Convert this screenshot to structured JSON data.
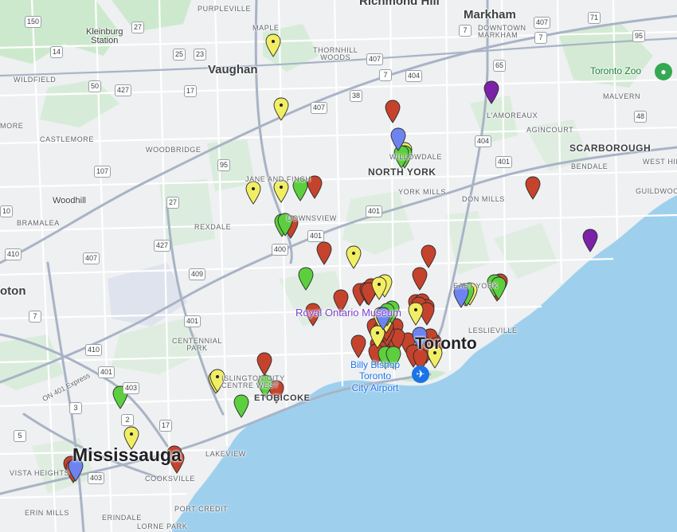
{
  "map": {
    "colors": {
      "land": "#eef0f1",
      "water": "#9ed0ee",
      "park": "#cde9cd",
      "highway": "#a9b3c6",
      "road": "#ffffff",
      "marker_red": "#c5432c",
      "marker_yellow": "#f2ee63",
      "marker_green": "#5ccf3e",
      "marker_blue": "#6d84f0",
      "marker_purple": "#7b22a8"
    },
    "labels": {
      "richmond_hill": "Richmond Hill",
      "markham": "Markham",
      "downtown_markham": "DOWNTOWN\nMARKHAM",
      "purpleville": "PURPLEVILLE",
      "maple": "MAPLE",
      "kleinburg_station": "Kleinburg\nStation",
      "vaughan": "Vaughan",
      "thornhill_woods": "THORNHILL\nWOODS",
      "toronto_zoo": "Toronto Zoo",
      "malvern": "MALVERN",
      "wildfield": "WILDFIELD",
      "lamoreaux": "L'AMOREAUX",
      "agincourt": "AGINCOURT",
      "more": "MORE",
      "castlemore": "CASTLEMORE",
      "woodbridge": "WOODBRIDGE",
      "willowdale": "WILLOWDALE",
      "north_york": "NORTH YORK",
      "scarborough": "SCARBOROUGH",
      "bendale": "BENDALE",
      "west_hill": "WEST HIL",
      "guildwood": "GUILDWOO",
      "jane_and_finch": "JANE AND FINCH",
      "woodhill": "Woodhill",
      "york_mills": "YORK MILLS",
      "don_mills": "DON MILLS",
      "bramalea": "BRAMALEA",
      "downsview": "DOWNSVIEW",
      "rexdale": "REXDALE",
      "east_york": "EAST YORK",
      "oton": "oton",
      "rom": "Royal Ontario Museum",
      "leslieville": "LESLIEVILLE",
      "centennial_park": "CENTENNIAL\nPARK",
      "toronto": "Toronto",
      "airport": "Billy Bishop\nToronto\nCity Airport",
      "islington": "ISLINGTON CITY\nCENTRE WEST",
      "etobicoke": "ETOBICOKE",
      "on401express": "ON 401 Express",
      "mississauga": "Mississauga",
      "lakeview": "LAKEVIEW",
      "vista_heights": "VISTA HEIGHTS",
      "cooksville": "COOKSVILLE",
      "port_credit": "PORT CREDIT",
      "erin_mills": "ERIN MILLS",
      "erindale": "ERINDALE",
      "lorne_park": "LORNE PARK"
    },
    "shields": [
      "150",
      "27",
      "14",
      "25",
      "23",
      "7",
      "407",
      "71",
      "7",
      "407",
      "95",
      "65",
      "427",
      "50",
      "17",
      "7",
      "407",
      "38",
      "48",
      "404",
      "404",
      "401",
      "107",
      "95",
      "27",
      "10",
      "401",
      "410",
      "407",
      "427",
      "400",
      "401",
      "409",
      "401",
      "410",
      "401",
      "7",
      "403",
      "3",
      "17",
      "403",
      "5",
      "2"
    ],
    "marker_groups": {
      "red": 52,
      "yellow": 18,
      "green": 16,
      "blue": 5,
      "purple": 2
    }
  }
}
